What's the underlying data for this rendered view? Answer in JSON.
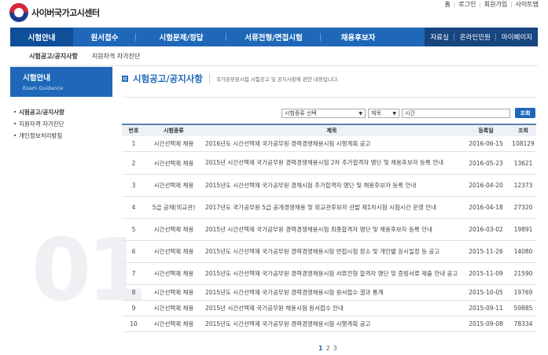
{
  "header": {
    "logo_text": "사이버국가고시센터",
    "util_links": [
      "홈",
      "로그인",
      "회원가입",
      "사이트맵"
    ]
  },
  "gnb": {
    "items": [
      "시험안내",
      "원서접수",
      "시험문제/정답",
      "서류전형/면접시험",
      "채용후보자"
    ],
    "right_items": [
      "자료실",
      "온라인민원",
      "마이페이지"
    ]
  },
  "subnav": {
    "items": [
      "시험공고/공지사항",
      "지원자격 자가진단"
    ]
  },
  "sidebar": {
    "title": "시험안내",
    "subtitle": "Exam Guidance",
    "items": [
      "시험공고/공지사항",
      "지원자격 자가진단",
      "개인정보처리방침"
    ],
    "bg_number": "01"
  },
  "content": {
    "title": "시험공고/공지사항",
    "description": "국가공무원시험 시험공고 및 공지사항에 관한 내용입니다."
  },
  "search": {
    "type_select": "시험종류 선택",
    "field_select": "제목",
    "input_value": "시간",
    "button_label": "조회"
  },
  "table": {
    "headers": {
      "no": "번호",
      "type": "시험종류",
      "title": "제목",
      "date": "등록일",
      "views": "조회"
    },
    "rows": [
      {
        "no": "1",
        "type": "시간선택제 채용",
        "title": "2016년도 시간선택제 국가공무원 경력경쟁채용시험 시행계획 공고",
        "date": "2016-06-15",
        "views": "108129"
      },
      {
        "no": "2",
        "type": "시간선택제 채용",
        "title": "2015년 시간선택제 국가공무원 경력경쟁채용시험 2차 추가합격자 명단 및 채용후보자 등록 안내",
        "date": "2016-05-23",
        "views": "13621"
      },
      {
        "no": "3",
        "type": "시간선택제 채용",
        "title": "2015년도 시간선택제 국가공무원 경채시험 추가합격자 명단 및 채용후보자 등록 안내",
        "date": "2016-04-20",
        "views": "12373"
      },
      {
        "no": "4",
        "type": "5급 공채(외교관)",
        "title": "2017년도 국가공무원 5급 공개경쟁채용 및 외교관후보자 선발 제1차시험 시험시간 운영 안내",
        "date": "2016-04-18",
        "views": "27320"
      },
      {
        "no": "5",
        "type": "시간선택제 채용",
        "title": "2015년 시간선택제 국가공무원 경력경쟁채용시험 최종합격자 명단 및 채용후보자 등록 안내",
        "date": "2016-03-02",
        "views": "19891"
      },
      {
        "no": "6",
        "type": "시간선택제 채용",
        "title": "2015년도 시간선택제 국가공무원 경력경쟁채용시험 면접시험 장소 및 개인별 응시일정 등 공고",
        "date": "2015-11-26",
        "views": "14080"
      },
      {
        "no": "7",
        "type": "시간선택제 채용",
        "title": "2015년도 시간선택제 국가공무원 경력경쟁채용시험 서류전형 합격자 명단 및 증빙서류 제출 안내 공고",
        "date": "2015-11-09",
        "views": "21590"
      },
      {
        "no": "8",
        "type": "시간선택제 채용",
        "title": "2015년도 시간선택제 국가공무원 경력경쟁채용시험 원서접수 결과 통계",
        "date": "2015-10-05",
        "views": "19769"
      },
      {
        "no": "9",
        "type": "시간선택제 채용",
        "title": "2015년 시간선택제 국가공무원 채용시험 원서접수 안내",
        "date": "2015-09-11",
        "views": "59885"
      },
      {
        "no": "10",
        "type": "시간선택제 채용",
        "title": "2015년도 시간선택제 국가공무원 경력경쟁채용시험 시행계획 공고",
        "date": "2015-09-08",
        "views": "78334"
      }
    ]
  },
  "pager": {
    "pages": [
      "1",
      "2",
      "3"
    ],
    "current": "1"
  },
  "colors": {
    "primary": "#1f68b9",
    "dark": "#17457f",
    "active": "#0f4f99"
  }
}
